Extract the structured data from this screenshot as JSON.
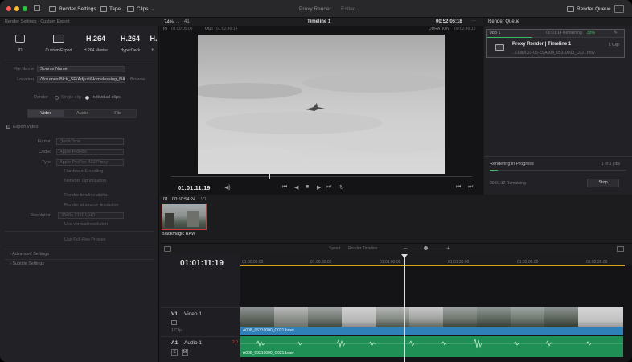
{
  "topbar": {
    "render_settings": "Render Settings",
    "tape": "Tape",
    "clips": "Clips",
    "title": "Proxy Render",
    "status": "Edited",
    "render_queue": "Render Queue"
  },
  "left_panel": {
    "header": "Render Settings - Custom Export",
    "presets": [
      {
        "icon": "target-icon",
        "label": "ID"
      },
      {
        "icon": "monitor-icon",
        "label": "Custom Export"
      },
      {
        "icon": "text",
        "text": "H.264",
        "label": "H.264 Master"
      },
      {
        "icon": "text",
        "text": "H.264",
        "label": "HyperDeck"
      },
      {
        "icon": "text",
        "text": "H.",
        "label": "H."
      }
    ],
    "filename_label": "File Name",
    "filename_value": "Source Name",
    "location_label": "Location",
    "location_value": "/Volumes/Blck_SP/Adjust/Homelessing_NAS/9",
    "browse": "Browse",
    "render_label": "Render",
    "single_clip": "Single clip",
    "individual_clips": "Individual clips",
    "tabs": [
      "Video",
      "Audio",
      "File"
    ],
    "export_video": "Export Video",
    "format_label": "Format",
    "format_value": "QuickTime",
    "codec_label": "Codec",
    "codec_value": "Apple ProRes",
    "type_label": "Type",
    "type_value": "Apple ProRes 422 Proxy",
    "hardware": "Hardware Encoding",
    "network": "Network Optimization",
    "render_alpha": "Render timeline alpha",
    "render_at_source": "Render at source resolution",
    "resolution_label": "Resolution",
    "resolution_value": "3840x 2160 UHD",
    "use_vertical": "Use vertical resolution",
    "use_proxies": "Use Full-Res Proxies",
    "advanced": "Advanced Settings",
    "subtitle": "Subtitle Settings"
  },
  "viewer": {
    "zoom": "74%",
    "zoom_arrow": "⌄",
    "frame_count": "41",
    "timeline_name": "Timeline 1",
    "timecode": "00:52:06:18",
    "in_label": "IN",
    "in_value": "01:00:00:00",
    "out_label": "OUT",
    "out_value": "01:02:46:14",
    "duration_label": "DURATION",
    "duration_value": "00:02:46:15",
    "current_timecode": "01:01:11:19"
  },
  "render_queue": {
    "header": "Render Queue",
    "job_label": "Job 1",
    "job_remaining": "00:01:14 Remaining",
    "job_percent": "33%",
    "job_title": "Proxy Render | Timeline 1",
    "job_clips": "1 Clip",
    "job_path": ".../Jul/2023-05-23/A008_05310000_C021.mov",
    "progress_label": "Rendering in Progress",
    "jobs_count": "1 of 1 jobs",
    "remaining": "00:01:12 Remaining",
    "stop": "Stop",
    "progress": 0.33
  },
  "media": {
    "clip_number": "01",
    "clip_timecode": "00:50:54:24",
    "clip_track": "V1",
    "clip_name": "Blackmagic RAW"
  },
  "timeline": {
    "current_timecode": "01:01:11:19",
    "ticks": [
      "01:00:00:00",
      "01:00:30:00",
      "01:01:00:00",
      "01:01:30:00",
      "01:02:00:00",
      "01:02:30:00"
    ],
    "v1_label": "V1",
    "v1_name": "Video 1",
    "v1_clips": "1 Clip",
    "a1_label": "A1",
    "a1_name": "Audio 1",
    "a1_level": "2.0",
    "video_clip_name": "A008_05310000_C021.braw",
    "audio_clip_name": "A008_05310000_C021.braw",
    "toolbar_speed": "Speed",
    "toolbar_mode": "Render Timeline"
  }
}
